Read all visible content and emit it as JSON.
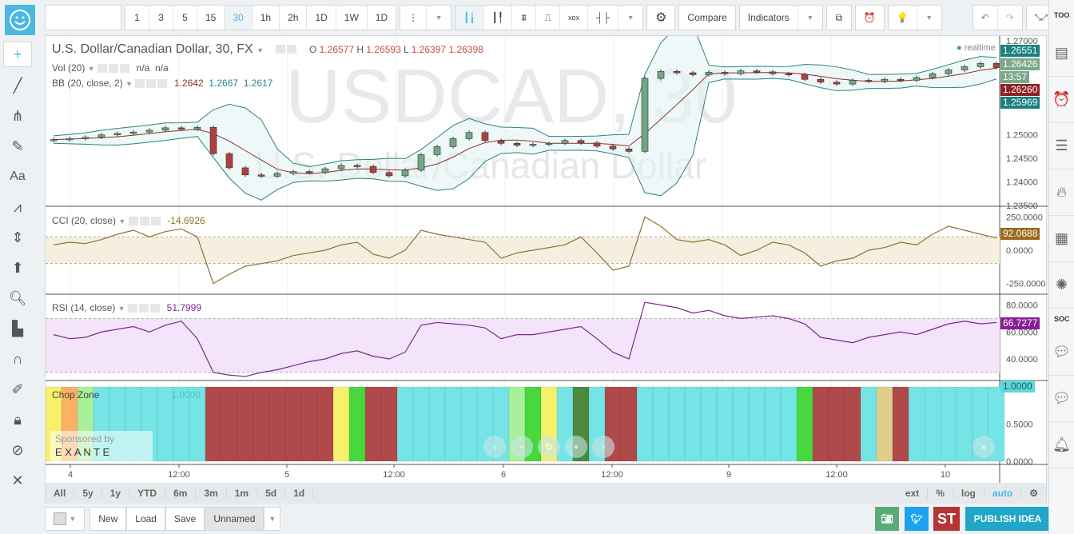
{
  "topbar": {
    "intervals": [
      "1",
      "3",
      "5",
      "15",
      "30",
      "1h",
      "2h",
      "1D",
      "1W",
      "1D"
    ],
    "active_interval": "30",
    "compare_label": "Compare",
    "indicators_label": "Indicators"
  },
  "left_tools": [
    "crosshair-icon",
    "trend-line-icon",
    "pitchfork-icon",
    "brush-icon",
    "text-icon",
    "pattern-icon",
    "measure-icon",
    "arrow-up-icon",
    "zoom-icon",
    "volume-profile-icon",
    "magnet-icon",
    "lock-drawing-icon",
    "lock-icon",
    "hide-icon",
    "tools-icon"
  ],
  "left_tools_text": {
    "text": "Aa"
  },
  "legend": {
    "symbol": "U.S. Dollar/Canadian Dollar, 30, FX",
    "o_label": "O",
    "o": "1.26577",
    "h_label": "H",
    "h": "1.26593",
    "l_label": "L",
    "l": "1.26397",
    "c": "1.26398",
    "vol_label": "Vol (20)",
    "vol_v1": "n/a",
    "vol_v2": "n/a",
    "bb_label": "BB (20, close, 2)",
    "bb_basis": "1.2642",
    "bb_upper": "1.2667",
    "bb_lower": "1.2617",
    "realtime": "realtime",
    "cci_label": "CCI (20, close)",
    "cci_value": "-14.6926",
    "rsi_label": "RSI (14, close)",
    "rsi_value": "51.7999",
    "chop_label": "Chop Zone",
    "chop_value": "1.0000",
    "sponsor_label": "Sponsored by",
    "sponsor_name": "E X A N T E"
  },
  "watermark": {
    "ticker": "USDCAD, 30",
    "name": "U.S. Dollar/Canadian Dollar"
  },
  "price_tags": [
    {
      "text": "1.26551",
      "color": "#1a8080"
    },
    {
      "text": "1.26426",
      "color": "#7aa88a"
    },
    {
      "text": "13:57",
      "color": "#7aa88a"
    },
    {
      "text": "1.26260",
      "color": "#8e2323"
    },
    {
      "text": "1.25969",
      "color": "#1a8080"
    }
  ],
  "indicator_tags": {
    "cci": "92.0688",
    "cci_color": "#9a6b1c",
    "rsi": "66.7277",
    "rsi_color": "#8a1e96",
    "chop": "1.0000",
    "chop_color": "#5fd8dc"
  },
  "colors": {
    "up": "#6fa882",
    "down": "#b04040",
    "bb": "#2b8080",
    "basis": "#8b3030",
    "cci": "#8a7230",
    "rsi": "#7a2a8a"
  },
  "chart_data": [
    {
      "type": "candlestick",
      "name": "U.S. Dollar/Canadian Dollar",
      "ylim": [
        1.235,
        1.27
      ],
      "yticks": [
        "1.27000",
        "1.25000",
        "1.24500",
        "1.24000",
        "1.23500"
      ],
      "close": [
        1.249,
        1.2492,
        1.2495,
        1.25,
        1.2503,
        1.2506,
        1.251,
        1.2515,
        1.2512,
        1.2516,
        1.246,
        1.243,
        1.2415,
        1.2412,
        1.2418,
        1.2422,
        1.242,
        1.2428,
        1.2435,
        1.2433,
        1.242,
        1.2413,
        1.2425,
        1.2458,
        1.2475,
        1.2492,
        1.2505,
        1.2488,
        1.2482,
        1.2478,
        1.248,
        1.2482,
        1.2488,
        1.2483,
        1.2476,
        1.247,
        1.2465,
        1.262,
        1.2635,
        1.2632,
        1.2628,
        1.2633,
        1.263,
        1.2636,
        1.2634,
        1.263,
        1.2628,
        1.2618,
        1.2612,
        1.2608,
        1.2616,
        1.2614,
        1.2618,
        1.2616,
        1.2622,
        1.263,
        1.2638,
        1.2645,
        1.2652,
        1.2643
      ]
    },
    {
      "type": "line",
      "name": "CCI (20, close)",
      "ylim": [
        -330,
        330
      ],
      "yticks": [
        "250.0000",
        "0.0000",
        "-250.0000"
      ],
      "values": [
        40,
        60,
        50,
        80,
        120,
        150,
        100,
        140,
        160,
        100,
        -250,
        -180,
        -120,
        -100,
        -80,
        -40,
        -20,
        0,
        40,
        60,
        -30,
        -60,
        0,
        150,
        120,
        100,
        80,
        60,
        -60,
        -20,
        0,
        20,
        40,
        100,
        -20,
        -150,
        -120,
        250,
        180,
        80,
        60,
        80,
        40,
        -40,
        0,
        60,
        40,
        -20,
        -120,
        -80,
        -60,
        0,
        20,
        60,
        40,
        120,
        180,
        150,
        120,
        92
      ]
    },
    {
      "type": "line",
      "name": "RSI (14, close)",
      "ylim": [
        24,
        88
      ],
      "yticks": [
        "80.0000",
        "60.0000",
        "40.0000"
      ],
      "values": [
        58,
        55,
        56,
        60,
        62,
        64,
        60,
        65,
        68,
        55,
        30,
        28,
        27,
        30,
        32,
        35,
        38,
        40,
        44,
        46,
        42,
        40,
        45,
        65,
        67,
        66,
        65,
        63,
        55,
        58,
        58,
        60,
        62,
        64,
        55,
        45,
        40,
        82,
        80,
        78,
        74,
        76,
        72,
        70,
        71,
        72,
        70,
        66,
        56,
        54,
        52,
        56,
        58,
        60,
        58,
        62,
        66,
        68,
        66,
        67
      ]
    },
    {
      "type": "bar",
      "name": "Chop Zone",
      "ylim": [
        0,
        1
      ],
      "yticks": [
        "1.0000",
        "0.5000",
        "0.0000"
      ],
      "zones": [
        "yellow",
        "orange",
        "lightgreen",
        "turq",
        "turq",
        "turq",
        "turq",
        "turq",
        "turq",
        "turq",
        "red",
        "red",
        "red",
        "red",
        "red",
        "red",
        "red",
        "red",
        "yellow",
        "green",
        "red",
        "red",
        "turq",
        "turq",
        "turq",
        "turq",
        "turq",
        "turq",
        "turq",
        "lightgreen",
        "green",
        "yellow",
        "turq",
        "darkgreen",
        "turq",
        "red",
        "red",
        "turq",
        "turq",
        "turq",
        "turq",
        "turq",
        "turq",
        "turq",
        "turq",
        "turq",
        "turq",
        "green",
        "red",
        "red",
        "red",
        "turq",
        "tan",
        "red",
        "turq",
        "turq",
        "turq",
        "turq",
        "turq",
        "turq"
      ],
      "zone_colors": {
        "turq": "#74e4e6",
        "red": "#b04a4a",
        "yellow": "#f6f06a",
        "orange": "#fbb064",
        "lightgreen": "#a8f09a",
        "green": "#46d83c",
        "darkgreen": "#4d8a3c",
        "tan": "#e0cf8a"
      }
    }
  ],
  "time_axis": [
    "4",
    "12:00",
    "5",
    "12:00",
    "6",
    "12:00",
    "9",
    "12:00",
    "10"
  ],
  "range_buttons": [
    "All",
    "5y",
    "1y",
    "YTD",
    "6m",
    "3m",
    "1m",
    "5d",
    "1d"
  ],
  "scale_buttons": [
    "ext",
    "%",
    "log",
    "auto"
  ],
  "bottom": {
    "new": "New",
    "load": "Load",
    "save": "Save",
    "layout_name": "Unnamed",
    "publish": "PUBLISH IDEA",
    "stocktwits": "ST"
  },
  "right_panel": {
    "tools_label": "TOO",
    "social_label": "SOC"
  }
}
